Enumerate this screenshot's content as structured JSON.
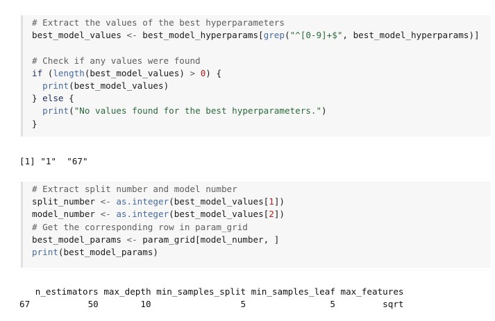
{
  "cell1": {
    "lines": [
      "# Extract the values of the best hyperparameters",
      "best_model_values <- best_model_hyperparams[grep(\"^[0-9]+$\", best_model_hyperparams)]",
      "",
      "# Check if any values were found",
      "if (length(best_model_values) > 0) {",
      "  print(best_model_values)",
      "} else {",
      "  print(\"No values found for the best hyperparameters.\")",
      "}"
    ]
  },
  "output1": "[1] \"1\"  \"67\"",
  "cell2": {
    "lines": [
      "# Extract split number and model number",
      "split_number <- as.integer(best_model_values[1])",
      "model_number <- as.integer(best_model_values[2])",
      "# Get the corresponding row in param_grid",
      "best_model_params <- param_grid[model_number, ]",
      "print(best_model_params)"
    ]
  },
  "output2": {
    "header": "   n_estimators max_depth min_samples_split min_samples_leaf max_features",
    "row": "67           50        10                 5                5         sqrt"
  }
}
